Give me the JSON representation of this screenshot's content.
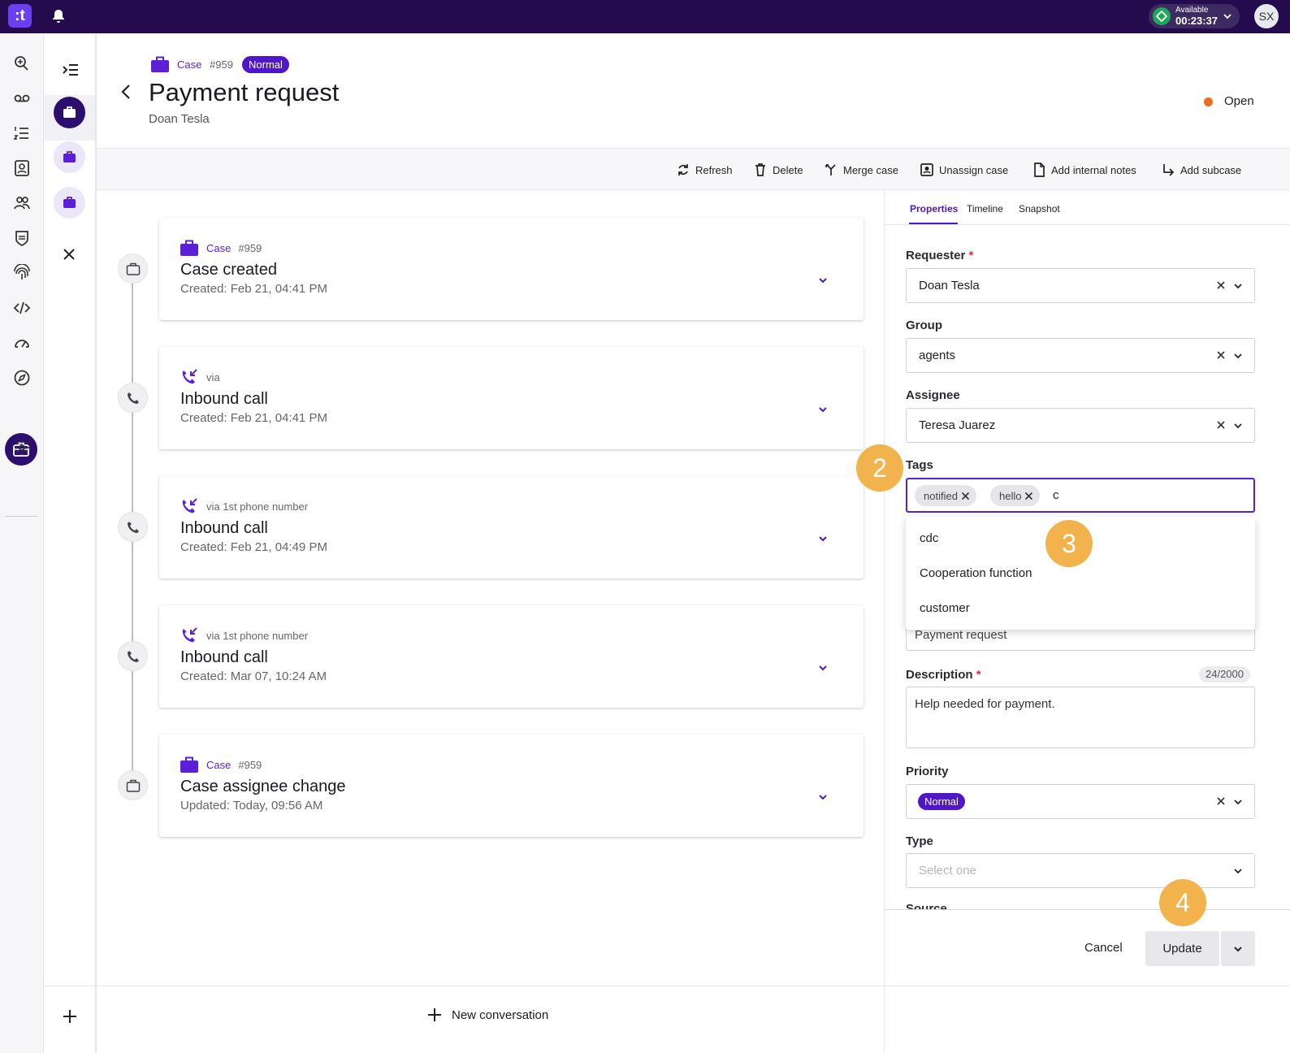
{
  "topbar": {
    "logo": ":t",
    "status_label": "Available",
    "status_timer": "00:23:37",
    "avatar_initials": "SX",
    "status_color": "#1fa85c"
  },
  "header": {
    "case_label": "Case",
    "case_number": "#959",
    "priority_badge": "Normal",
    "title": "Payment request",
    "requester": "Doan Tesla",
    "status": "Open",
    "status_color": "#f06a1c"
  },
  "toolbar": {
    "refresh": "Refresh",
    "delete": "Delete",
    "merge": "Merge case",
    "unassign": "Unassign case",
    "notes": "Add internal notes",
    "subcase": "Add subcase"
  },
  "timeline": [
    {
      "kind": "case",
      "type_label": "Case",
      "number": "#959",
      "title": "Case created",
      "date": "Created: Feb 21, 04:41 PM"
    },
    {
      "kind": "call",
      "via": "via",
      "title": "Inbound call",
      "date": "Created: Feb 21, 04:41 PM"
    },
    {
      "kind": "call",
      "via": "via 1st phone number",
      "title": "Inbound call",
      "date": "Created: Feb 21, 04:49 PM"
    },
    {
      "kind": "call",
      "via": "via 1st phone number",
      "title": "Inbound call",
      "date": "Created: Mar 07, 10:24 AM"
    },
    {
      "kind": "case",
      "type_label": "Case",
      "number": "#959",
      "title": "Case assignee change",
      "date": "Updated: Today, 09:56 AM"
    }
  ],
  "new_conversation": "New conversation",
  "panel": {
    "tabs": [
      "Properties",
      "Timeline",
      "Snapshot"
    ],
    "requester_label": "Requester",
    "requester_value": "Doan Tesla",
    "group_label": "Group",
    "group_value": "agents",
    "assignee_label": "Assignee",
    "assignee_value": "Teresa Juarez",
    "tags_label": "Tags",
    "tags": [
      "notified",
      "hello"
    ],
    "tags_input": "c",
    "tag_options": [
      "cdc",
      "Cooperation function",
      "customer"
    ],
    "summary_value": "Payment request",
    "description_label": "Description",
    "description_counter": "24/2000",
    "description_value": "Help needed for payment.",
    "priority_label": "Priority",
    "priority_value": "Normal",
    "type_label": "Type",
    "type_placeholder": "Select one",
    "source_label": "Source",
    "cancel": "Cancel",
    "update": "Update",
    "required_mark": "*"
  },
  "steps": [
    "2",
    "3",
    "4"
  ]
}
